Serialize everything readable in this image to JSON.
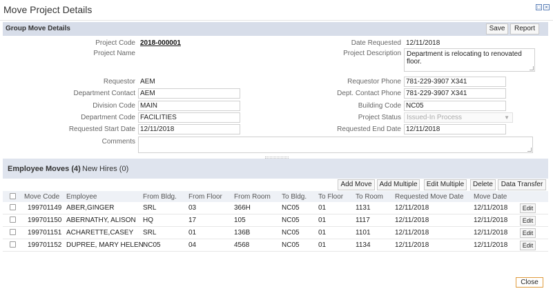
{
  "window": {
    "title": "Move Project Details",
    "maximize_glyph": "□",
    "close_glyph": "×"
  },
  "group": {
    "title": "Group Move Details",
    "save_label": "Save",
    "report_label": "Report"
  },
  "form": {
    "project_code_label": "Project Code",
    "project_code": "2018-000001",
    "project_name_label": "Project Name",
    "project_name": "",
    "date_requested_label": "Date Requested",
    "date_requested": "12/11/2018",
    "project_description_label": "Project Description",
    "project_description": "Department is relocating to renovated floor.",
    "requestor_label": "Requestor",
    "requestor": "AEM",
    "requestor_phone_label": "Requestor Phone",
    "requestor_phone": "781-229-3907 X341",
    "department_contact_label": "Department Contact",
    "department_contact": "AEM",
    "dept_contact_phone_label": "Dept. Contact Phone",
    "dept_contact_phone": "781-229-3907 X341",
    "division_code_label": "Division Code",
    "division_code": "MAIN",
    "building_code_label": "Building Code",
    "building_code": "NC05",
    "department_code_label": "Department Code",
    "department_code": "FACILITIES",
    "project_status_label": "Project Status",
    "project_status": "Issued-In Process",
    "requested_start_date_label": "Requested Start Date",
    "requested_start_date": "12/11/2018",
    "requested_end_date_label": "Requested End Date",
    "requested_end_date": "12/11/2018",
    "comments_label": "Comments",
    "comments": ""
  },
  "tabs": {
    "employee_moves": "Employee Moves (4)",
    "new_hires": "New Hires (0)"
  },
  "toolbar": {
    "add_move": "Add Move",
    "add_multiple": "Add Multiple",
    "edit_multiple": "Edit Multiple",
    "delete": "Delete",
    "data_transfer": "Data Transfer"
  },
  "grid": {
    "columns": [
      "Move Code",
      "Employee",
      "From Bldg.",
      "From Floor",
      "From Room",
      "To Bldg.",
      "To Floor",
      "To Room",
      "Requested Move Date",
      "Move Date"
    ],
    "edit_label": "Edit",
    "rows": [
      {
        "move_code": "199701149",
        "employee": "ABER,GINGER",
        "from_bldg": "SRL",
        "from_floor": "03",
        "from_room": "366H",
        "to_bldg": "NC05",
        "to_floor": "01",
        "to_room": "1131",
        "requested_move_date": "12/11/2018",
        "move_date": "12/11/2018"
      },
      {
        "move_code": "199701150",
        "employee": "ABERNATHY, ALISON",
        "from_bldg": "HQ",
        "from_floor": "17",
        "from_room": "105",
        "to_bldg": "NC05",
        "to_floor": "01",
        "to_room": "1117",
        "requested_move_date": "12/11/2018",
        "move_date": "12/11/2018"
      },
      {
        "move_code": "199701151",
        "employee": "ACHARETTE,CASEY",
        "from_bldg": "SRL",
        "from_floor": "01",
        "from_room": "136B",
        "to_bldg": "NC05",
        "to_floor": "01",
        "to_room": "1101",
        "requested_move_date": "12/11/2018",
        "move_date": "12/11/2018"
      },
      {
        "move_code": "199701152",
        "employee": "DUPREE, MARY HELEN",
        "from_bldg": "NC05",
        "from_floor": "04",
        "from_room": "4568",
        "to_bldg": "NC05",
        "to_floor": "01",
        "to_room": "1134",
        "requested_move_date": "12/11/2018",
        "move_date": "12/11/2018"
      }
    ]
  },
  "footer": {
    "close_label": "Close"
  }
}
